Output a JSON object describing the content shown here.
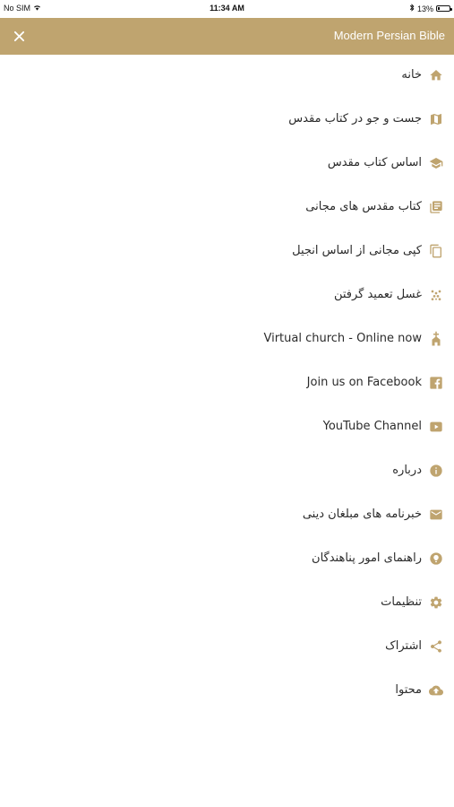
{
  "status_bar": {
    "carrier": "No SIM",
    "time": "11:34 AM",
    "battery": "13%",
    "battery_level": 0.13
  },
  "header": {
    "title": "Modern Persian Bible",
    "close_icon": "close-icon"
  },
  "colors": {
    "accent": "#bfa46f",
    "text": "#2b2b2b",
    "background": "#ffffff"
  },
  "menu": {
    "items": [
      {
        "label": "خانه",
        "icon": "home-icon"
      },
      {
        "label": "جست و جو در  کتاب مقدس",
        "icon": "map-icon"
      },
      {
        "label": "اساس کتاب مقدس",
        "icon": "graduation-cap-icon"
      },
      {
        "label": "کتاب مقدس های مجانی",
        "icon": "library-books-icon"
      },
      {
        "label": "کپی مجانی از اساس انجیل",
        "icon": "copy-icon"
      },
      {
        "label": "غسل تعمید گرفتن",
        "icon": "sparkle-icon"
      },
      {
        "label": "Virtual church - Online now",
        "icon": "church-icon"
      },
      {
        "label": "Join us on Facebook",
        "icon": "facebook-icon"
      },
      {
        "label": "YouTube Channel",
        "icon": "youtube-icon"
      },
      {
        "label": "درباره",
        "icon": "info-icon"
      },
      {
        "label": "خبرنامه های مبلغان دینی",
        "icon": "mail-icon"
      },
      {
        "label": "راهنمای امور پناهندگان",
        "icon": "lightbulb-icon"
      },
      {
        "label": "تنظیمات",
        "icon": "gear-icon"
      },
      {
        "label": "اشتراک",
        "icon": "share-icon"
      },
      {
        "label": "محتوا",
        "icon": "cloud-upload-icon"
      }
    ]
  }
}
